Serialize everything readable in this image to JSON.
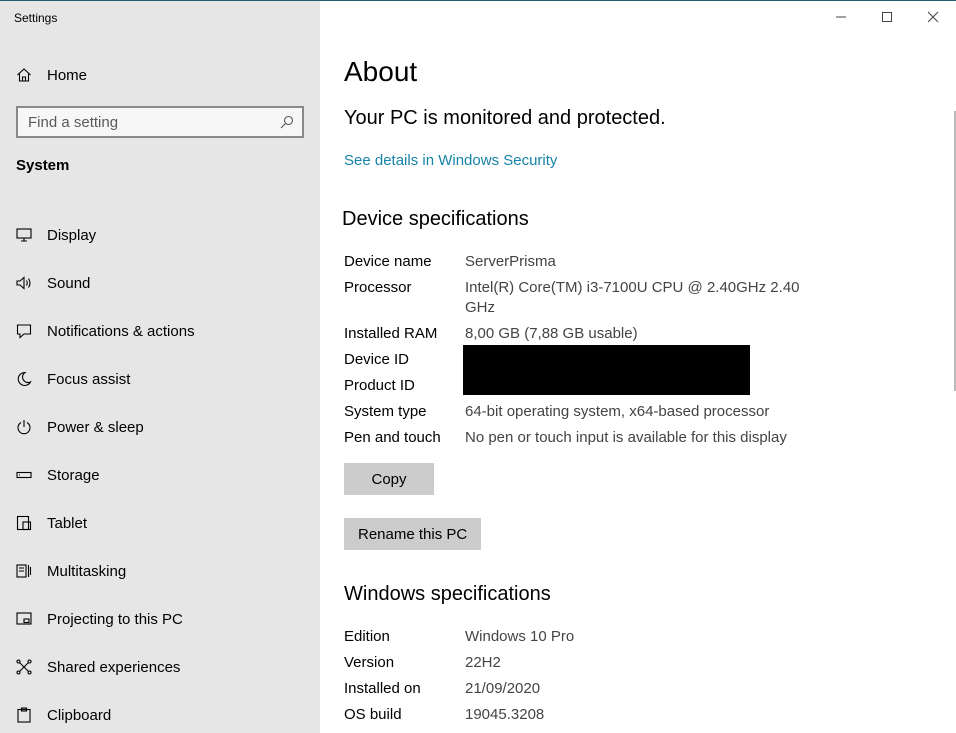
{
  "window": {
    "title": "Settings"
  },
  "sidebar": {
    "home_label": "Home",
    "search_placeholder": "Find a setting",
    "section_title": "System",
    "items": [
      {
        "label": "Display",
        "icon": "display-icon"
      },
      {
        "label": "Sound",
        "icon": "sound-icon"
      },
      {
        "label": "Notifications & actions",
        "icon": "notifications-icon"
      },
      {
        "label": "Focus assist",
        "icon": "moon-icon"
      },
      {
        "label": "Power & sleep",
        "icon": "power-icon"
      },
      {
        "label": "Storage",
        "icon": "storage-icon"
      },
      {
        "label": "Tablet",
        "icon": "tablet-icon"
      },
      {
        "label": "Multitasking",
        "icon": "multitasking-icon"
      },
      {
        "label": "Projecting to this PC",
        "icon": "projecting-icon"
      },
      {
        "label": "Shared experiences",
        "icon": "shared-experiences-icon"
      },
      {
        "label": "Clipboard",
        "icon": "clipboard-icon"
      }
    ]
  },
  "main": {
    "title": "About",
    "protection_status": "Your PC is monitored and protected.",
    "security_link": "See details in Windows Security",
    "device_heading": "Device specifications",
    "device_specs": [
      {
        "key": "Device name",
        "value": "ServerPrisma"
      },
      {
        "key": "Processor",
        "value": "Intel(R) Core(TM) i3-7100U CPU @ 2.40GHz   2.40 GHz"
      },
      {
        "key": "Installed RAM",
        "value": "8,00 GB (7,88 GB usable)"
      },
      {
        "key": "Device ID",
        "value": ""
      },
      {
        "key": "Product ID",
        "value": ""
      },
      {
        "key": "System type",
        "value": "64-bit operating system, x64-based processor"
      },
      {
        "key": "Pen and touch",
        "value": "No pen or touch input is available for this display"
      }
    ],
    "copy_button": "Copy",
    "rename_button": "Rename this PC",
    "windows_heading": "Windows specifications",
    "windows_specs": [
      {
        "key": "Edition",
        "value": "Windows 10 Pro"
      },
      {
        "key": "Version",
        "value": "22H2"
      },
      {
        "key": "Installed on",
        "value": "21/09/2020"
      },
      {
        "key": "OS build",
        "value": "19045.3208"
      }
    ]
  },
  "colors": {
    "sidebar_bg": "#e6e6e6",
    "link": "#1783a8",
    "button_bg": "#cccccc"
  }
}
